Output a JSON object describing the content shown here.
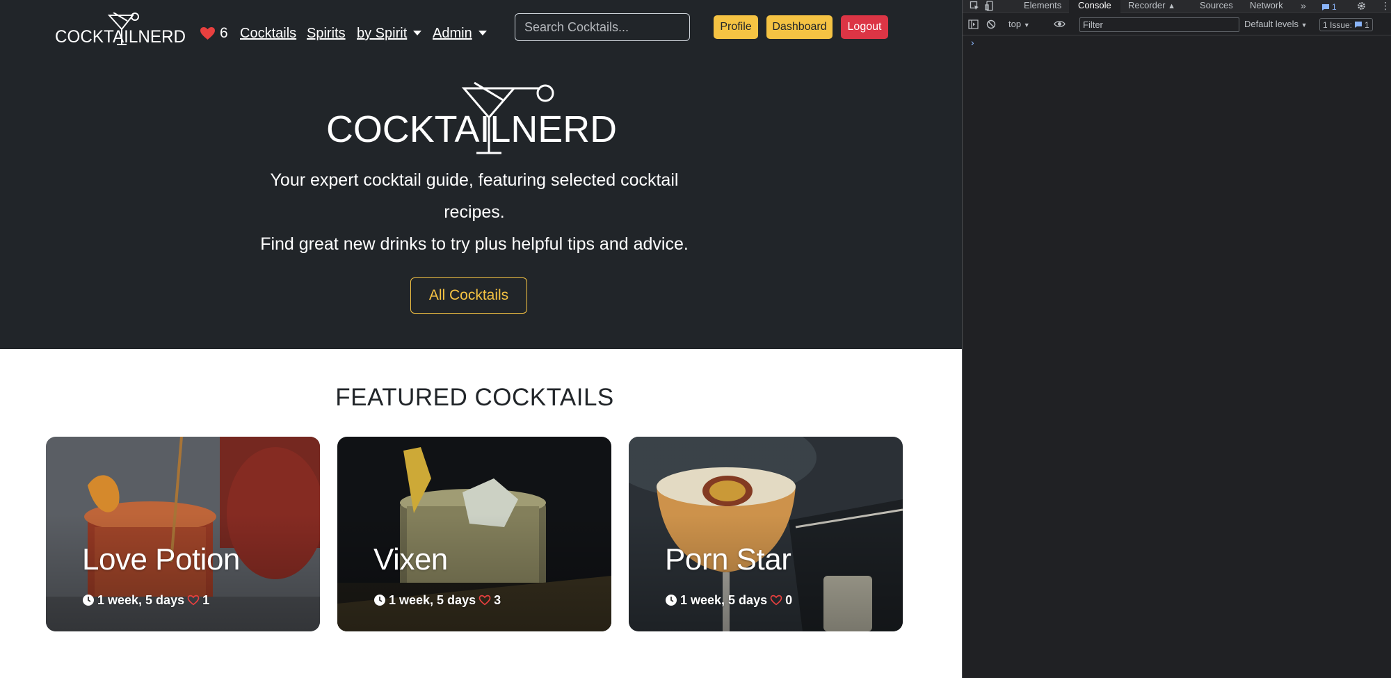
{
  "navbar": {
    "brand": "COCKTAILNERD",
    "favorites_count": "6",
    "links": [
      {
        "label": "Cocktails",
        "dropdown": false
      },
      {
        "label": "Spirits",
        "dropdown": false
      },
      {
        "label": "by Spirit",
        "dropdown": true
      },
      {
        "label": "Admin",
        "dropdown": true
      }
    ],
    "search_placeholder": "Search Cocktails...",
    "buttons": {
      "profile": "Profile",
      "dashboard": "Dashboard",
      "logout": "Logout"
    }
  },
  "hero": {
    "logo_text": "COCKTAILNERD",
    "tagline_line1": "Your expert cocktail guide, featuring selected cocktail",
    "tagline_line2": "recipes.",
    "tagline_line3": "Find great new drinks to try plus helpful tips and advice.",
    "cta_label": "All Cocktails"
  },
  "featured": {
    "title": "FEATURED COCKTAILS",
    "cards": [
      {
        "name": "Love Potion",
        "age": "1 week, 5 days",
        "likes": "1"
      },
      {
        "name": "Vixen",
        "age": "1 week, 5 days",
        "likes": "3"
      },
      {
        "name": "Porn Star",
        "age": "1 week, 5 days",
        "likes": "0"
      }
    ]
  },
  "devtools": {
    "tabs": [
      "Elements",
      "Console",
      "Recorder",
      "Sources",
      "Network"
    ],
    "active_tab": "Console",
    "messages_badge": "1",
    "context": "top",
    "filter_placeholder": "Filter",
    "levels": "Default levels",
    "issues_label": "1 Issue:",
    "issues_count": "1",
    "prompt": "›"
  },
  "colors": {
    "hero_bg": "#212529",
    "accent_yellow": "#f5c343",
    "danger_red": "#dc3545",
    "heart_red": "#e8403f",
    "devtools_bg": "#202124",
    "devtools_link": "#8ab4f8"
  },
  "icons": {
    "favorites": "heart-icon",
    "card_age": "clock-icon",
    "card_likes": "heart-outline-icon",
    "brand": "martini-glass-icon"
  }
}
